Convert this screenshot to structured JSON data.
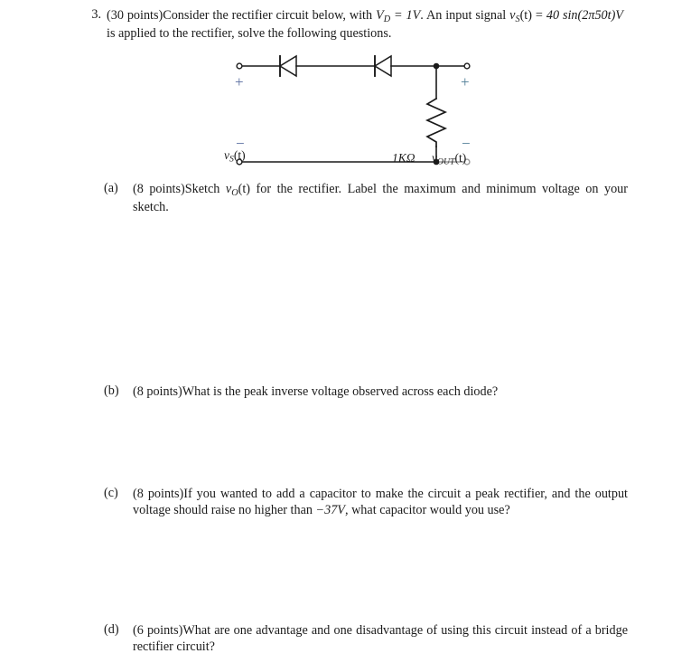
{
  "document": {
    "type": "exam-question-sheet"
  },
  "problem": {
    "number": "3.",
    "points": "(30 points)",
    "line1_a": "(30 points)",
    "line1_b": "Consider the rectifier circuit below, with ",
    "vd_symbol": "V",
    "vd_sub": "D",
    "vd_value": " = 1V",
    "line1_c": ".  An input signal ",
    "vs_symbol": "v",
    "vs_sub": "S",
    "vs_arg": "(t)",
    "line1_d": " =",
    "line2_a": "40 sin(2π50t)V",
    "line2_b": " is applied to the rectifier, solve the following questions."
  },
  "circuit": {
    "source_label_v": "v",
    "source_label_sub": "S",
    "source_label_arg": "(t)",
    "resistor_label": "1KΩ",
    "output_label_v": "v",
    "output_label_sub": "OUT",
    "output_label_arg": "(t)",
    "plus_left": "+",
    "plus_right": "+",
    "minus_left": "−",
    "minus_right": "−",
    "diode_count": 2,
    "wire_color": "#1a1a1a",
    "sign_color": "#5a6ea0"
  },
  "parts": [
    {
      "tag": "(a)",
      "points": "(8 points)",
      "text_a": "Sketch ",
      "sym_v": "v",
      "sym_sub": "O",
      "sym_arg": "(t)",
      "text_b": " for the rectifier.  Label the maximum and minimum voltage on your sketch."
    },
    {
      "tag": "(b)",
      "points": "(8 points)",
      "text_a": "What is the peak inverse voltage observed across each diode?",
      "sym_v": "",
      "sym_sub": "",
      "sym_arg": "",
      "text_b": ""
    },
    {
      "tag": "(c)",
      "points": "(8 points)",
      "text_a": "If you wanted to add a capacitor to make the circuit a peak rectifier, and the output voltage should raise no higher than ",
      "sym_v": "−37V",
      "sym_sub": "",
      "sym_arg": "",
      "text_b": ", what capacitor would you use?"
    },
    {
      "tag": "(d)",
      "points": "(6 points)",
      "text_a": "What are one advantage and one disadvantage of using this circuit instead of a bridge rectifier circuit?",
      "sym_v": "",
      "sym_sub": "",
      "sym_arg": "",
      "text_b": ""
    }
  ]
}
